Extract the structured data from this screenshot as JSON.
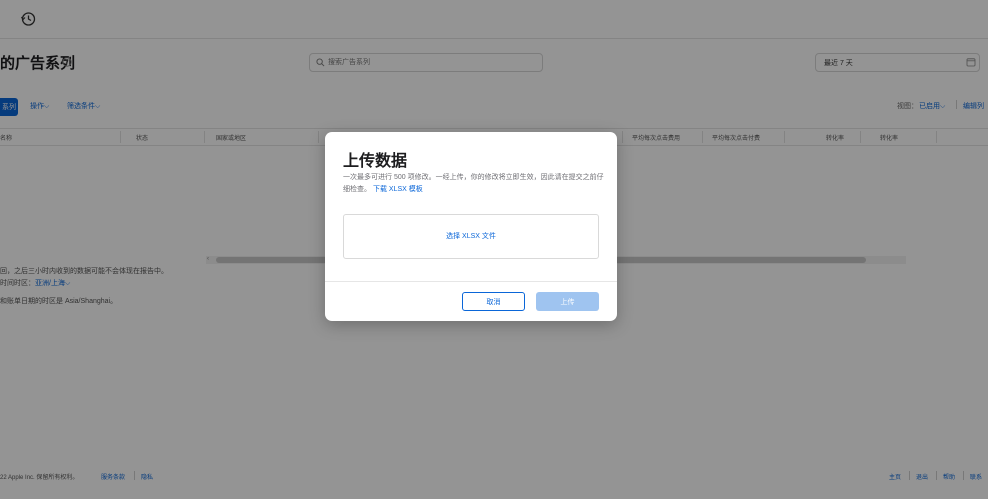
{
  "page": {
    "title": "的广告系列",
    "search_placeholder": "搜索广告系列",
    "date_range": "最近 7 天"
  },
  "toolbar": {
    "create": "系列",
    "actions": "操作",
    "filter": "筛选条件",
    "view_label": "视图：",
    "view_value": "已启用",
    "edit_columns": "编辑列"
  },
  "table": {
    "columns": [
      "名称",
      "状态",
      "国家或地区",
      "",
      "平均每次点击费用",
      "平均每次点击付费",
      "转化率",
      "转化率"
    ]
  },
  "notes": {
    "line1": "回，之后三小时内收到的数据可能不会体现在报告中。",
    "tz_label": "时间时区：",
    "tz_value": "亚洲/上海",
    "line3": "和账单日期的时区是 Asia/Shanghai。"
  },
  "footer": {
    "copyright": "22 Apple Inc. 保留所有权利。",
    "terms": "服务条款",
    "privacy": "隐私",
    "home": "主页",
    "logout": "退出",
    "help": "帮助",
    "contact": "联系"
  },
  "modal": {
    "title": "上传数据",
    "desc": "一次最多可进行 500 项修改。一经上传，你的修改将立即生效，因此请在提交之前仔细检查。",
    "download_link": "下载 XLSX 模板",
    "choose_file": "选择 XLSX 文件",
    "cancel": "取消",
    "upload": "上传"
  }
}
